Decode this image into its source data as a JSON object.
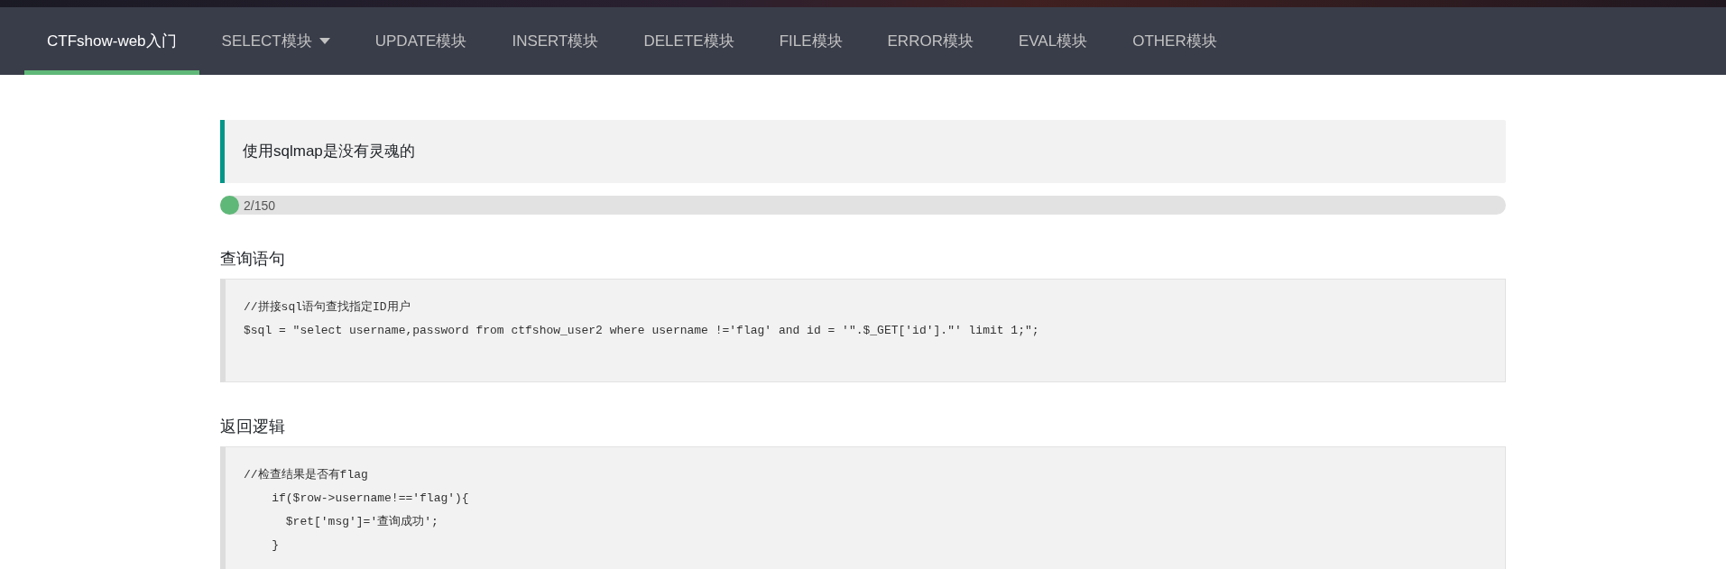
{
  "nav": [
    {
      "label": "CTFshow-web入门",
      "selected": true,
      "dropdown": false
    },
    {
      "label": "SELECT模块",
      "selected": false,
      "dropdown": true
    },
    {
      "label": "UPDATE模块",
      "selected": false,
      "dropdown": false
    },
    {
      "label": "INSERT模块",
      "selected": false,
      "dropdown": false
    },
    {
      "label": "DELETE模块",
      "selected": false,
      "dropdown": false
    },
    {
      "label": "FILE模块",
      "selected": false,
      "dropdown": false
    },
    {
      "label": "ERROR模块",
      "selected": false,
      "dropdown": false
    },
    {
      "label": "EVAL模块",
      "selected": false,
      "dropdown": false
    },
    {
      "label": "OTHER模块",
      "selected": false,
      "dropdown": false
    }
  ],
  "notice": "使用sqlmap是没有灵魂的",
  "progress": {
    "level": 0.0133,
    "reading": "2/150"
  },
  "sections": [
    {
      "heading": "查询语句",
      "code": [
        "//拼接sql语句查找指定ID用户",
        "$sql = \"select username,password from ctfshow_user2 where username !='flag' and id = '\".$_GET['id'].\"' limit 1;\";"
      ]
    },
    {
      "heading": "返回逻辑",
      "code": [
        "//检查结果是否有flag",
        "    if($row->username!=='flag'){",
        "      $ret['msg']='查询成功';",
        "    }"
      ]
    }
  ]
}
